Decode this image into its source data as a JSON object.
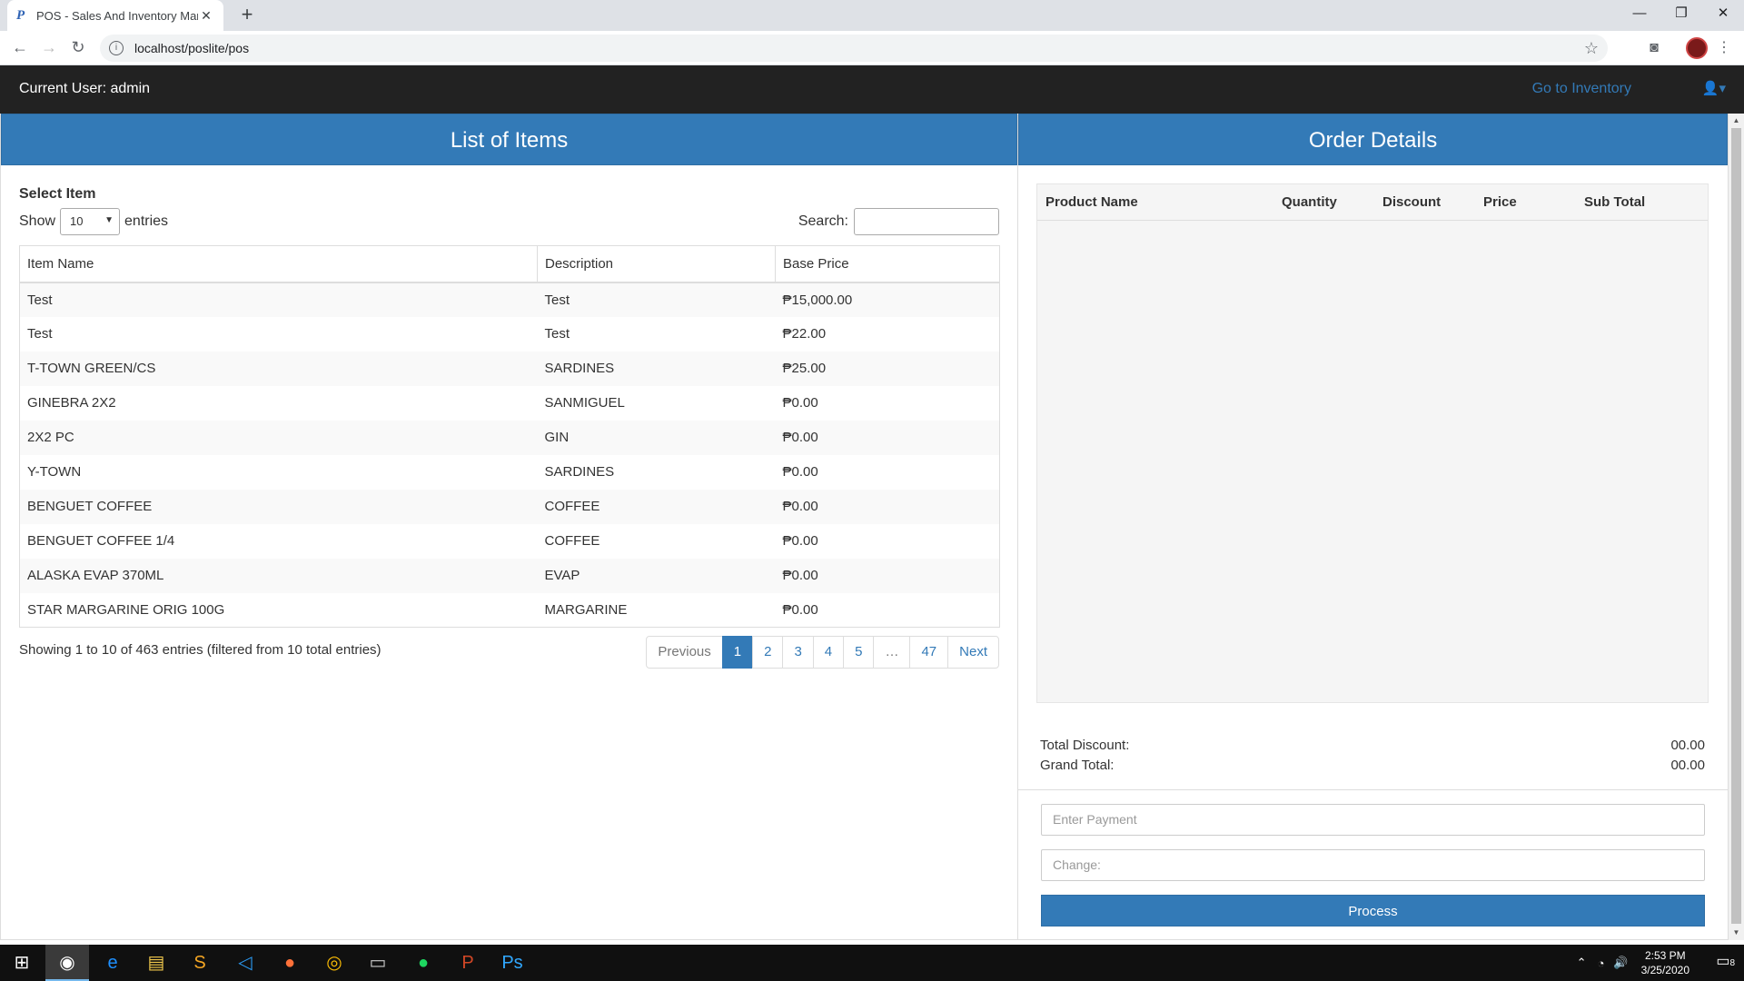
{
  "browser": {
    "tab_title": "POS - Sales And Inventory Mana",
    "url": "localhost/poslite/pos"
  },
  "navbar": {
    "current_user": "Current User: admin",
    "go_inventory": "Go to Inventory"
  },
  "items_panel": {
    "title": "List of Items",
    "select_label": "Select Item",
    "show_label": "Show",
    "entries_label": "entries",
    "page_size": "10",
    "search_label": "Search:",
    "columns": [
      "Item Name",
      "Description",
      "Base Price"
    ],
    "rows": [
      [
        "Test",
        "Test",
        "₱15,000.00"
      ],
      [
        "Test",
        "Test",
        "₱22.00"
      ],
      [
        "T-TOWN GREEN/CS",
        "SARDINES",
        "₱25.00"
      ],
      [
        "GINEBRA 2X2",
        "SANMIGUEL",
        "₱0.00"
      ],
      [
        "2X2 PC",
        "GIN",
        "₱0.00"
      ],
      [
        "Y-TOWN",
        "SARDINES",
        "₱0.00"
      ],
      [
        "BENGUET COFFEE",
        "COFFEE",
        "₱0.00"
      ],
      [
        "BENGUET COFFEE 1/4",
        "COFFEE",
        "₱0.00"
      ],
      [
        "ALASKA EVAP 370ML",
        "EVAP",
        "₱0.00"
      ],
      [
        "STAR MARGARINE ORIG 100G",
        "MARGARINE",
        "₱0.00"
      ]
    ],
    "info": "Showing 1 to 10 of 463 entries (filtered from 10 total entries)",
    "pagination": {
      "previous": "Previous",
      "pages": [
        "1",
        "2",
        "3",
        "4",
        "5",
        "…",
        "47"
      ],
      "next": "Next"
    }
  },
  "order_panel": {
    "title": "Order Details",
    "columns": [
      "Product Name",
      "Quantity",
      "Discount",
      "Price",
      "Sub Total"
    ],
    "total_discount_label": "Total Discount:",
    "total_discount_value": "00.00",
    "grand_total_label": "Grand Total:",
    "grand_total_value": "00.00",
    "payment_placeholder": "Enter Payment",
    "change_placeholder": "Change:",
    "process_label": "Process"
  },
  "taskbar": {
    "time": "2:53 PM",
    "date": "3/25/2020",
    "notif_count": "8"
  }
}
